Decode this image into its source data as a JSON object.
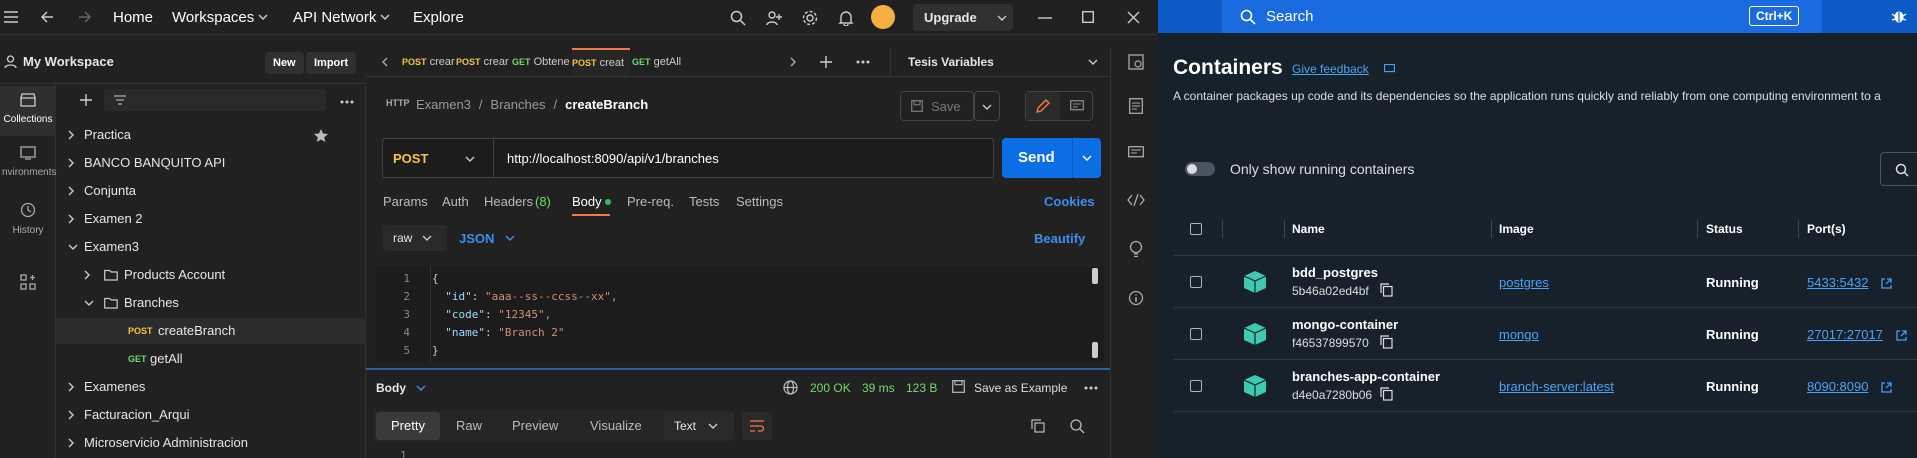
{
  "postman": {
    "nav": {
      "home": "Home",
      "workspaces": "Workspaces",
      "api_network": "API Network",
      "explore": "Explore",
      "upgrade": "Upgrade"
    },
    "workspace": {
      "title": "My Workspace",
      "new": "New",
      "import": "Import"
    },
    "rail": {
      "collections": "Collections",
      "environments": "nvironments",
      "history": "History"
    },
    "tree": [
      {
        "label": "Practica",
        "indent": 0,
        "type": "collection",
        "expanded": false
      },
      {
        "label": "BANCO BANQUITO API",
        "indent": 0,
        "type": "collection",
        "expanded": false
      },
      {
        "label": "Conjunta",
        "indent": 0,
        "type": "collection",
        "expanded": false
      },
      {
        "label": "Examen 2",
        "indent": 0,
        "type": "collection",
        "expanded": false
      },
      {
        "label": "Examen3",
        "indent": 0,
        "type": "collection",
        "expanded": true
      },
      {
        "label": "Products Account",
        "indent": 1,
        "type": "folder",
        "expanded": false
      },
      {
        "label": "Branches",
        "indent": 1,
        "type": "folder",
        "expanded": true
      },
      {
        "label": "createBranch",
        "indent": 2,
        "type": "request",
        "method": "POST",
        "selected": true
      },
      {
        "label": "getAll",
        "indent": 2,
        "type": "request",
        "method": "GET"
      },
      {
        "label": "Examenes",
        "indent": 0,
        "type": "collection",
        "expanded": false
      },
      {
        "label": "Facturacion_Arqui",
        "indent": 0,
        "type": "collection",
        "expanded": false
      },
      {
        "label": "Microservicio Administracion",
        "indent": 0,
        "type": "collection",
        "expanded": false
      }
    ],
    "tabs": [
      {
        "method": "POST",
        "label": "crear"
      },
      {
        "method": "POST",
        "label": "crear"
      },
      {
        "method": "GET",
        "label": "Obtene"
      },
      {
        "method": "POST",
        "label": "creat",
        "active": true
      },
      {
        "method": "GET",
        "label": "getAll"
      }
    ],
    "environment": "Tesis Variables",
    "breadcrumb": {
      "collection": "Examen3",
      "folder": "Branches",
      "request": "createBranch"
    },
    "save": "Save",
    "request": {
      "method": "POST",
      "url": "http://localhost:8090/api/v1/branches",
      "send": "Send"
    },
    "subtabs": {
      "params": "Params",
      "auth": "Auth",
      "headers": "Headers",
      "headers_count": "(8)",
      "body": "Body",
      "prereq": "Pre-req.",
      "tests": "Tests",
      "settings": "Settings",
      "cookies": "Cookies"
    },
    "body_mode": {
      "raw": "raw",
      "format": "JSON",
      "beautify": "Beautify"
    },
    "code_lines": [
      {
        "n": "1",
        "text": "{"
      },
      {
        "n": "2",
        "key": "\"id\"",
        "val": "\"aaa--ss--ccss--xx\","
      },
      {
        "n": "3",
        "key": "\"code\"",
        "val": "\"12345\","
      },
      {
        "n": "4",
        "key": "\"name\"",
        "val": "\"Branch 2\""
      },
      {
        "n": "5",
        "text": "}"
      }
    ],
    "response": {
      "label": "Body",
      "status": "200 OK",
      "time": "39 ms",
      "size": "123 B",
      "save_example": "Save as Example",
      "views": {
        "pretty": "Pretty",
        "raw": "Raw",
        "preview": "Preview",
        "visualize": "Visualize",
        "text": "Text"
      },
      "line1": "1"
    }
  },
  "docker": {
    "search": "Search",
    "shortcut": "Ctrl+K",
    "title": "Containers",
    "feedback": "Give feedback",
    "description": "A container packages up code and its dependencies so the application runs quickly and reliably from one computing environment to a",
    "toggle_label": "Only show running containers",
    "columns": {
      "name": "Name",
      "image": "Image",
      "status": "Status",
      "ports": "Port(s)"
    },
    "rows": [
      {
        "name": "bdd_postgres",
        "id": "5b46a02ed4bf",
        "image": "postgres",
        "status": "Running",
        "port": "5433:5432"
      },
      {
        "name": "mongo-container",
        "id": "f46537899570",
        "image": "mongo",
        "status": "Running",
        "port": "27017:27017"
      },
      {
        "name": "branches-app-container",
        "id": "d4e0a7280b06",
        "image": "branch-server:latest",
        "status": "Running",
        "port": "8090:8090"
      }
    ],
    "colors": {
      "accent": "#0d59c6",
      "running": "#ffffff",
      "link": "#4aa3f5"
    }
  }
}
